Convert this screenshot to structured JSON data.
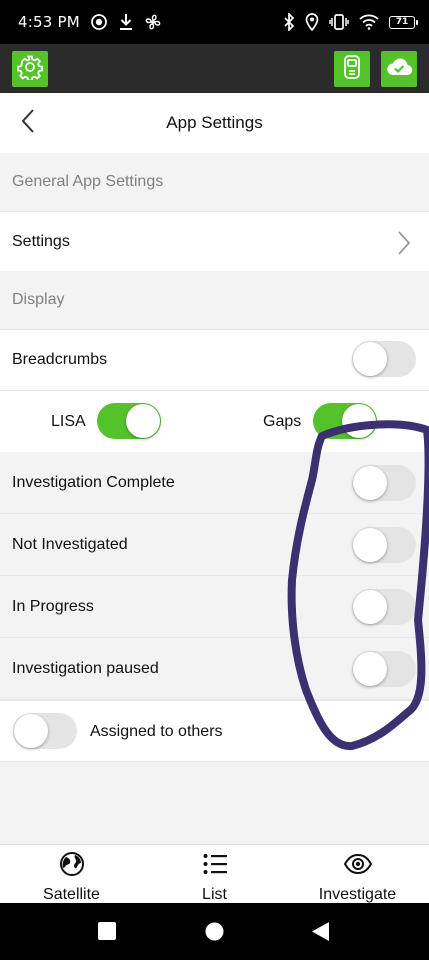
{
  "status_bar": {
    "time": "4:53 PM",
    "battery_level": "71",
    "left_icons": [
      "screen-record-icon",
      "download-icon",
      "fan-icon"
    ],
    "right_icons": [
      "bluetooth-icon",
      "location-icon",
      "vibrate-icon",
      "wifi-icon",
      "battery-icon"
    ]
  },
  "toolbar": {
    "left_icon": "gear-icon",
    "right_icons": [
      "device-icon",
      "cloud-check-icon"
    ],
    "accent_color": "#54c32a"
  },
  "header": {
    "title": "App Settings"
  },
  "sections": {
    "general_label": "General App Settings",
    "display_label": "Display"
  },
  "settings_row": {
    "label": "Settings"
  },
  "breadcrumbs": {
    "label": "Breadcrumbs",
    "on": false
  },
  "lisa": {
    "label": "LISA",
    "on": true
  },
  "gaps": {
    "label": "Gaps",
    "on": true
  },
  "status_filters": [
    {
      "label": "Investigation Complete",
      "on": false
    },
    {
      "label": "Not Investigated",
      "on": false
    },
    {
      "label": "In Progress",
      "on": false
    },
    {
      "label": "Investigation paused",
      "on": false
    }
  ],
  "assigned": {
    "label": "Assigned to others",
    "on": false
  },
  "bottom_nav": [
    {
      "label": "Satellite",
      "icon": "globe-icon"
    },
    {
      "label": "List",
      "icon": "list-icon"
    },
    {
      "label": "Investigate",
      "icon": "eye-icon"
    }
  ],
  "annotation": {
    "type": "hand-drawn loop",
    "color": "#3b3171"
  }
}
